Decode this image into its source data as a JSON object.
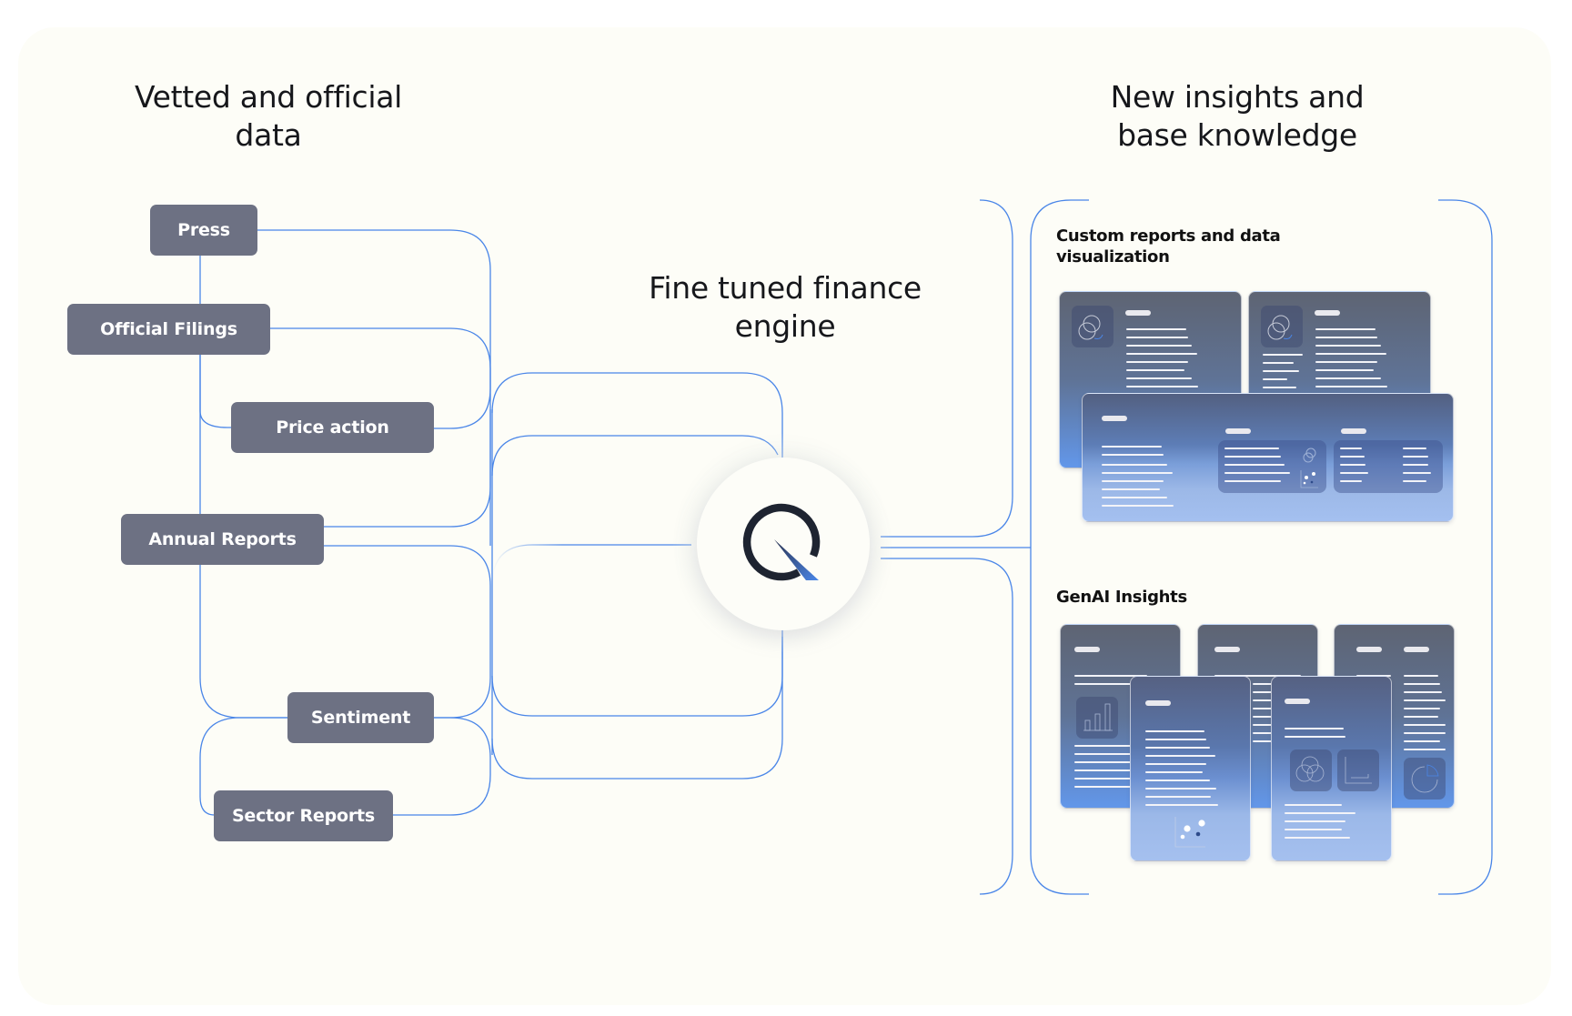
{
  "headings": {
    "sources": [
      "Vetted and official",
      "data"
    ],
    "engine": [
      "Fine tuned finance",
      "engine"
    ],
    "outputs": [
      "New insights and",
      "base knowledge"
    ]
  },
  "sources": [
    {
      "label": "Press"
    },
    {
      "label": "Official Filings"
    },
    {
      "label": "Price action"
    },
    {
      "label": "Annual Reports"
    },
    {
      "label": "Sentiment"
    },
    {
      "label": "Sector Reports"
    }
  ],
  "engine": {
    "logo": "q-logo-icon"
  },
  "outputs": [
    {
      "label": [
        "Custom reports and data",
        "visualization"
      ],
      "illustration": "report-dashboard-mockups"
    },
    {
      "label": [
        "GenAI Insights"
      ],
      "illustration": "insight-document-mockups"
    }
  ],
  "colors": {
    "background": "#fdfdf7",
    "node": "#6d7183",
    "wire": "#4a86e8",
    "text": "#16171b",
    "logo_ring": "#1e2431",
    "logo_accent": "#4a86e8"
  }
}
